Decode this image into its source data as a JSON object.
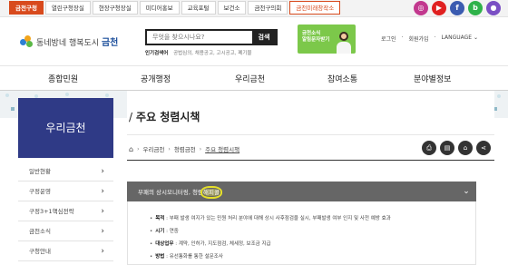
{
  "topbar": {
    "tabs": [
      "금천구청",
      "열린구청장실",
      "현장구청장실",
      "미디어홍보",
      "교육포털",
      "보건소",
      "금천구의회",
      "금천미래창작소"
    ],
    "sns": [
      {
        "icon": "instagram-icon",
        "glyph": "◎",
        "color": "#c2388e"
      },
      {
        "icon": "youtube-icon",
        "glyph": "▶",
        "color": "#e02020"
      },
      {
        "icon": "facebook-icon",
        "glyph": "f",
        "color": "#3b5bb0"
      },
      {
        "icon": "blog-icon",
        "glyph": "b",
        "color": "#2fb24a"
      },
      {
        "icon": "kakao-icon",
        "glyph": "●",
        "color": "#7a4fc4"
      }
    ]
  },
  "header": {
    "logo_prefix": "동네방네 행복도시",
    "logo_name": "금천",
    "search_placeholder": "무엇을 찾으시나요?",
    "search_button": "검색",
    "popular_label": "인기검색어",
    "popular_terms": "공법심의, 채용공고, 고시공고, 폐기물",
    "banner_text": "금천소식\n알림문자받기",
    "util": [
      "로그인",
      "회원가입",
      "LANGUAGE"
    ]
  },
  "gnb": [
    "종합민원",
    "공개행정",
    "우리금천",
    "참여소통",
    "분야별정보"
  ],
  "lnb": {
    "title": "우리금천",
    "items": [
      "일반현황",
      "구정운영",
      "구정3+1핵심전략",
      "금천소식",
      "구청안내"
    ]
  },
  "content": {
    "page_title": "주요 청렴시책",
    "breadcrumb": [
      "우리금천",
      "청렴금천",
      "주요 청렴시책"
    ],
    "tools": [
      {
        "icon": "print-icon",
        "glyph": "⎙"
      },
      {
        "icon": "document-icon",
        "glyph": "▤"
      },
      {
        "icon": "lock-icon",
        "glyph": "⌂"
      },
      {
        "icon": "share-icon",
        "glyph": "⋖"
      }
    ],
    "accordion": {
      "title_main": "부패의 상시모니터링, 청렴",
      "title_highlight": "해피콜",
      "items": [
        {
          "label": "목적",
          "text": " : 부패 발생 여지가 있는 민원 처리 분야에 대해 상시 사후점검을 실시, 부패발생 여부 인지 및 사전 예방 효과"
        },
        {
          "label": "시기",
          "text": " : 연중"
        },
        {
          "label": "대상업무",
          "text": " : 계약, 인허가, 지도점검, 체세정, 보조금 지급"
        },
        {
          "label": "방법",
          "text": " : 유선통화를 통한 설문조사"
        }
      ]
    }
  },
  "colors": {
    "accent": "#d84a1d",
    "lnb_title_bg": "#2f3a86",
    "accordion_head": "#666666",
    "highlight_ring": "#e6e02a"
  }
}
